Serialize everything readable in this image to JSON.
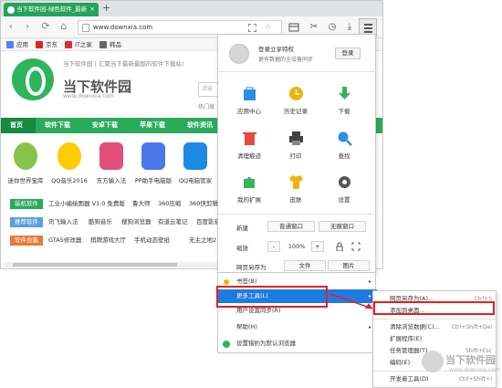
{
  "browser": {
    "tab_title": "当下软件园-绿色软件_最新",
    "tab_close": "×",
    "new_tab": "+",
    "url": "www.downxia.com",
    "star": "☆",
    "nav": {
      "back": "‹",
      "forward": "›",
      "refresh": "⟳",
      "home": "⌂"
    },
    "toolbar": {
      "cut": "✂",
      "history": "◷",
      "download": "⤓"
    },
    "bookmarks": [
      {
        "label": "应用",
        "color": "#4a86e8"
      },
      {
        "label": "京东",
        "color": "#e1251b"
      },
      {
        "label": "IT之家",
        "color": "#d8312a"
      },
      {
        "label": "韩品",
        "color": "#666666"
      }
    ]
  },
  "site": {
    "slogan": "当下软件园 | 汇聚当下最新最酷的软件下载站!",
    "name": "当下软件园",
    "domain": "www.downxia.com",
    "search_placeholder": "请输",
    "hot": "热门搜",
    "nav": [
      "首页",
      "软件下载",
      "安卓下载",
      "苹果下载",
      "软件资讯"
    ],
    "accent": "#2aaa5c",
    "apps": [
      {
        "label": "迷你世界宝库",
        "color": "#8bc34a"
      },
      {
        "label": "QQ音乐2016",
        "color": "#ffcc00"
      },
      {
        "label": "东方输入法",
        "color": "#e0507a"
      },
      {
        "label": "PP助手电脑版",
        "color": "#4a78e8"
      },
      {
        "label": "QQ电脑管家",
        "color": "#1e88e5"
      }
    ],
    "rows": [
      {
        "tag": "装机软件",
        "tag_color": "#2aaa5c",
        "items": [
          "工业小编绘图器 V1.0 免费版",
          "鲁大师",
          "360压缩",
          "360快剪辑"
        ]
      },
      {
        "tag": "推荐软件",
        "tag_color": "#5aa0e0",
        "items": [
          "讯飞输入法",
          "酷狗音乐",
          "搜狗浏览器",
          "有道云笔记",
          "百度影音"
        ]
      },
      {
        "tag": "软件合集",
        "tag_color": "#e87a3c",
        "items": [
          "GTA5修改器",
          "棋牌游戏大厅",
          "手机动态壁纸",
          "无主之地2"
        ]
      }
    ]
  },
  "menu": {
    "login_title": "登录立享特权",
    "login_sub": "更有数据的全设备同步",
    "login_button": "登录",
    "grid": [
      {
        "label": "应用中心",
        "color": "#2d8ee6"
      },
      {
        "label": "历史记录",
        "color": "#f3b10e"
      },
      {
        "label": "下载",
        "color": "#35b35a"
      },
      {
        "label": "清理痕迹",
        "color": "#e64a3c"
      },
      {
        "label": "打印",
        "color": "#444444"
      },
      {
        "label": "查找",
        "color": "#2d8ee6"
      },
      {
        "label": "我的扩展",
        "color": "#35b35a"
      },
      {
        "label": "皮肤",
        "color": "#f3b10e"
      },
      {
        "label": "设置",
        "color": "#555555"
      }
    ],
    "new_label": "新建",
    "new_window": "普通窗口",
    "incognito_window": "无痕窗口",
    "zoom_label": "缩放",
    "zoom_minus": "-",
    "zoom_value": "100%",
    "zoom_plus": "+",
    "save_as_label": "网页另存为",
    "save_file": "文件",
    "save_image": "图片",
    "items": [
      {
        "label": "书签(B)",
        "arrow": "▸"
      },
      {
        "label": "更多工具(L)",
        "arrow": "▸"
      },
      {
        "label": "用户设置同步(R)",
        "arrow": ""
      },
      {
        "label": "帮助(H)",
        "arrow": "▸"
      },
      {
        "label": "设置猎豹为默认浏览器",
        "arrow": ""
      }
    ],
    "submenu": [
      {
        "label": "网页另存为(A)...",
        "shortcut": "Ctrl+S"
      },
      {
        "label": "添加到桌面...",
        "shortcut": ""
      },
      {
        "label": "清除浏览数据(C)...",
        "shortcut": "Ctrl+Shift+Del"
      },
      {
        "label": "扩展程序(E)",
        "shortcut": ""
      },
      {
        "label": "任务管理器(T)",
        "shortcut": "Shift+Esc"
      },
      {
        "label": "编码(E)",
        "shortcut": ""
      },
      {
        "label": "开发者工具(D)",
        "shortcut": "Ctrl+Shift+I"
      }
    ],
    "highlight_color": "#1e7be0",
    "annotation_color": "#e81e1e"
  },
  "watermark": {
    "text": "当下软件园",
    "domain": "www.downxia.com"
  }
}
